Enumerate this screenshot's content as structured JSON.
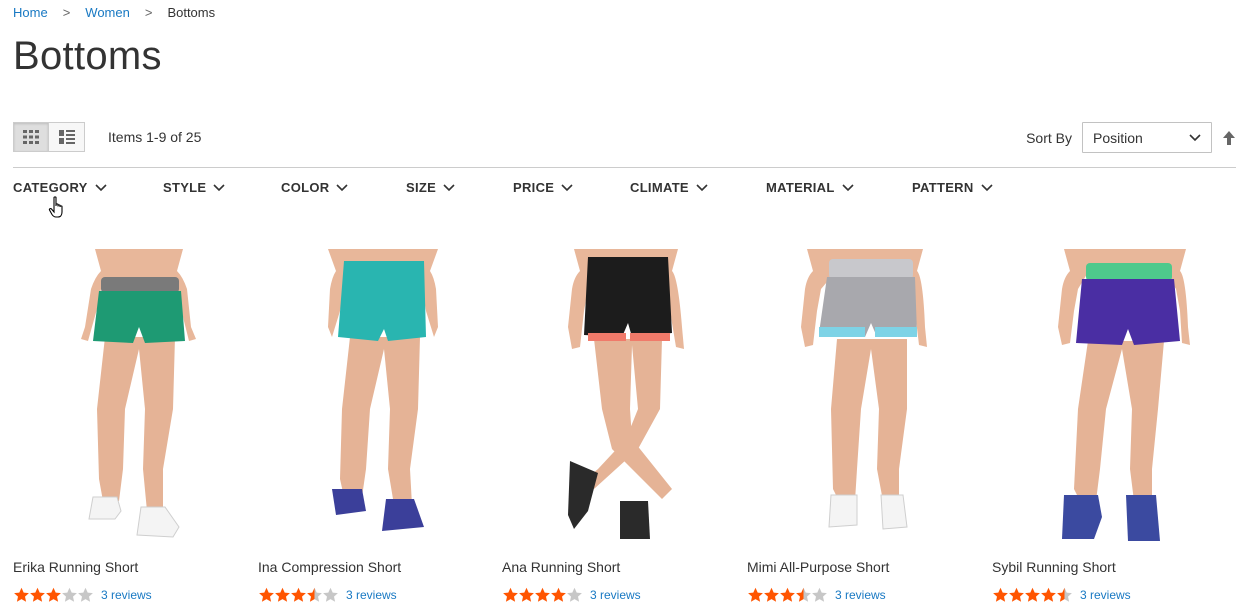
{
  "breadcrumb": {
    "home": "Home",
    "women": "Women",
    "current": "Bottoms",
    "separator": ">"
  },
  "page_title": "Bottoms",
  "toolbar": {
    "amount": "Items 1-9 of 25",
    "sort_label": "Sort By",
    "sort_value": "Position",
    "view_mode": "grid"
  },
  "filters": [
    "CATEGORY",
    "STYLE",
    "COLOR",
    "SIZE",
    "PRICE",
    "CLIMATE",
    "MATERIAL",
    "PATTERN"
  ],
  "colors": {
    "accent_link": "#1979c3",
    "star_filled": "#ff5501",
    "star_empty": "#c7c7c7"
  },
  "products": [
    {
      "name": "Erika Running Short",
      "rating": 3,
      "reviews": "3 reviews",
      "top_color": "#7a7a7a",
      "short_color": "#1e9a73",
      "shoe_color": "#f4f4f4"
    },
    {
      "name": "Ina Compression Short",
      "rating": 3.5,
      "reviews": "3 reviews",
      "top_color": "#29b5b0",
      "short_color": "#29b5b0",
      "shoe_color": "#3b3f9a"
    },
    {
      "name": "Ana Running Short",
      "rating": 4,
      "reviews": "3 reviews",
      "top_color": "#1c1c1c",
      "short_color": "#1c1c1c",
      "shoe_color": "#2a2a2a"
    },
    {
      "name": "Mimi All-Purpose Short",
      "rating": 3.5,
      "reviews": "3 reviews",
      "top_color": "#c8c8cc",
      "short_color": "#a8a8ad",
      "shoe_color": "#f4f4f4"
    },
    {
      "name": "Sybil Running Short",
      "rating": 4.5,
      "reviews": "3 reviews",
      "top_color": "#4ec98c",
      "short_color": "#4a2ea3",
      "shoe_color": "#3b4aa0"
    }
  ]
}
